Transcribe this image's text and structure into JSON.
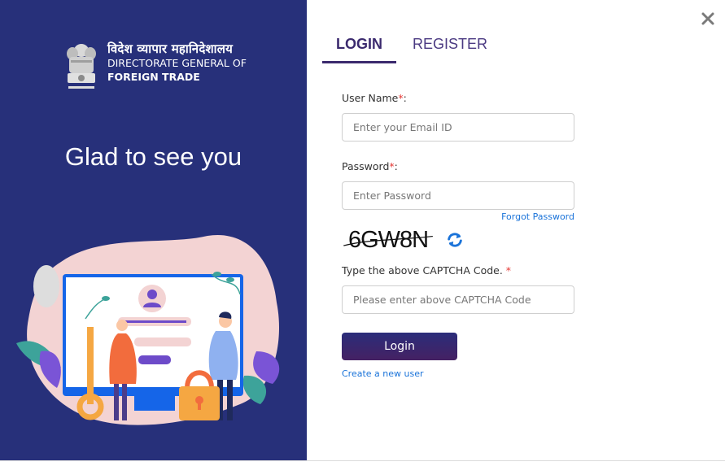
{
  "brand": {
    "hindi_name": "विदेश व्यापार महानिदेशालय",
    "line2": "DIRECTORATE GENERAL OF",
    "line3": "FOREIGN TRADE",
    "emblem_icon": "national-emblem-icon"
  },
  "welcome_text": "Glad to see you",
  "illustration": "login-security-illustration",
  "colors": {
    "panel_bg": "#27307a",
    "accent": "#3b2a6e",
    "link": "#1a73d9",
    "required": "#e53935"
  },
  "tabs": [
    {
      "label": "LOGIN",
      "active": true
    },
    {
      "label": "REGISTER",
      "active": false
    }
  ],
  "form": {
    "username": {
      "label": "User Name",
      "required_mark": "*",
      "suffix": ":",
      "placeholder": "Enter your Email ID",
      "value": ""
    },
    "password": {
      "label": "Password",
      "required_mark": "*",
      "suffix": ":",
      "placeholder": "Enter Password",
      "value": ""
    },
    "forgot_password": "Forgot Password",
    "captcha_text": "6GW8N",
    "captcha_label": "Type the above CAPTCHA Code. ",
    "captcha_required": "*",
    "captcha_input": {
      "placeholder": "Please enter above CAPTCHA Code",
      "value": ""
    },
    "login_button": "Login",
    "create_user": "Create a new user"
  },
  "icons": {
    "close": "close-icon",
    "refresh": "refresh-icon"
  }
}
